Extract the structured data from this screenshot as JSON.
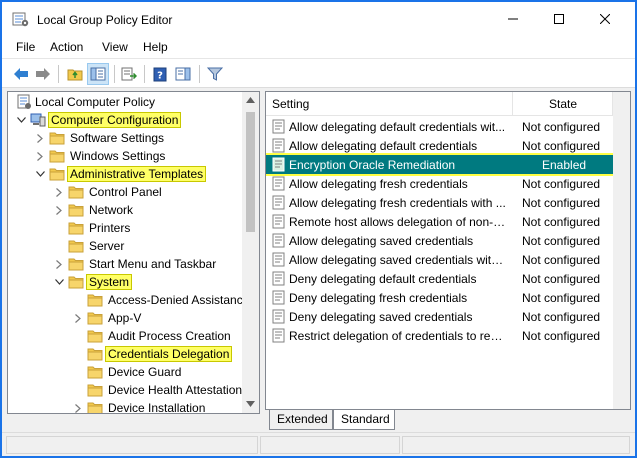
{
  "window": {
    "title": "Local Group Policy Editor"
  },
  "menu": [
    "File",
    "Action",
    "View",
    "Help"
  ],
  "tree": {
    "items": [
      {
        "label": "Local Computer Policy",
        "level": 0,
        "twisty": "",
        "icon": "policy-icon",
        "highlighted": false
      },
      {
        "label": "Computer Configuration",
        "level": 0,
        "twisty": "expanded",
        "icon": "computer-icon",
        "highlighted": true
      },
      {
        "label": "Software Settings",
        "level": 1,
        "twisty": "collapsed",
        "icon": "folder-icon",
        "highlighted": false
      },
      {
        "label": "Windows Settings",
        "level": 1,
        "twisty": "collapsed",
        "icon": "folder-icon",
        "highlighted": false
      },
      {
        "label": "Administrative Templates",
        "level": 1,
        "twisty": "expanded",
        "icon": "folder-icon",
        "highlighted": true
      },
      {
        "label": "Control Panel",
        "level": 2,
        "twisty": "collapsed",
        "icon": "folder-icon",
        "highlighted": false
      },
      {
        "label": "Network",
        "level": 2,
        "twisty": "collapsed",
        "icon": "folder-icon",
        "highlighted": false
      },
      {
        "label": "Printers",
        "level": 2,
        "twisty": "",
        "icon": "folder-icon",
        "highlighted": false
      },
      {
        "label": "Server",
        "level": 2,
        "twisty": "",
        "icon": "folder-icon",
        "highlighted": false
      },
      {
        "label": "Start Menu and Taskbar",
        "level": 2,
        "twisty": "collapsed",
        "icon": "folder-icon",
        "highlighted": false
      },
      {
        "label": "System",
        "level": 2,
        "twisty": "expanded",
        "icon": "folder-icon",
        "highlighted": true
      },
      {
        "label": "Access-Denied Assistance",
        "level": 3,
        "twisty": "",
        "icon": "folder-icon",
        "highlighted": false
      },
      {
        "label": "App-V",
        "level": 3,
        "twisty": "collapsed",
        "icon": "folder-icon",
        "highlighted": false
      },
      {
        "label": "Audit Process Creation",
        "level": 3,
        "twisty": "",
        "icon": "folder-icon",
        "highlighted": false
      },
      {
        "label": "Credentials Delegation",
        "level": 3,
        "twisty": "",
        "icon": "folder-icon",
        "highlighted": true
      },
      {
        "label": "Device Guard",
        "level": 3,
        "twisty": "",
        "icon": "folder-icon",
        "highlighted": false
      },
      {
        "label": "Device Health Attestation",
        "level": 3,
        "twisty": "",
        "icon": "folder-icon",
        "highlighted": false
      },
      {
        "label": "Device Installation",
        "level": 3,
        "twisty": "collapsed",
        "icon": "folder-icon",
        "highlighted": false
      }
    ]
  },
  "list": {
    "columns": {
      "setting": "Setting",
      "state": "State"
    },
    "rows": [
      {
        "setting": "Allow delegating default credentials wit...",
        "state": "Not configured",
        "selected": false
      },
      {
        "setting": "Allow delegating default credentials",
        "state": "Not configured",
        "selected": false
      },
      {
        "setting": "Encryption Oracle Remediation",
        "state": "Enabled",
        "selected": true
      },
      {
        "setting": "Allow delegating fresh credentials",
        "state": "Not configured",
        "selected": false
      },
      {
        "setting": "Allow delegating fresh credentials with ...",
        "state": "Not configured",
        "selected": false
      },
      {
        "setting": "Remote host allows delegation of non-e...",
        "state": "Not configured",
        "selected": false
      },
      {
        "setting": "Allow delegating saved credentials",
        "state": "Not configured",
        "selected": false
      },
      {
        "setting": "Allow delegating saved credentials with ...",
        "state": "Not configured",
        "selected": false
      },
      {
        "setting": "Deny delegating default credentials",
        "state": "Not configured",
        "selected": false
      },
      {
        "setting": "Deny delegating fresh credentials",
        "state": "Not configured",
        "selected": false
      },
      {
        "setting": "Deny delegating saved credentials",
        "state": "Not configured",
        "selected": false
      },
      {
        "setting": "Restrict delegation of credentials to rem...",
        "state": "Not configured",
        "selected": false
      }
    ]
  },
  "tabs": [
    "Extended",
    "Standard"
  ],
  "colors": {
    "selection": "#007a80",
    "highlight": "#ffff66",
    "window_border": "#1a73e8",
    "folder": "#f2c94c"
  }
}
